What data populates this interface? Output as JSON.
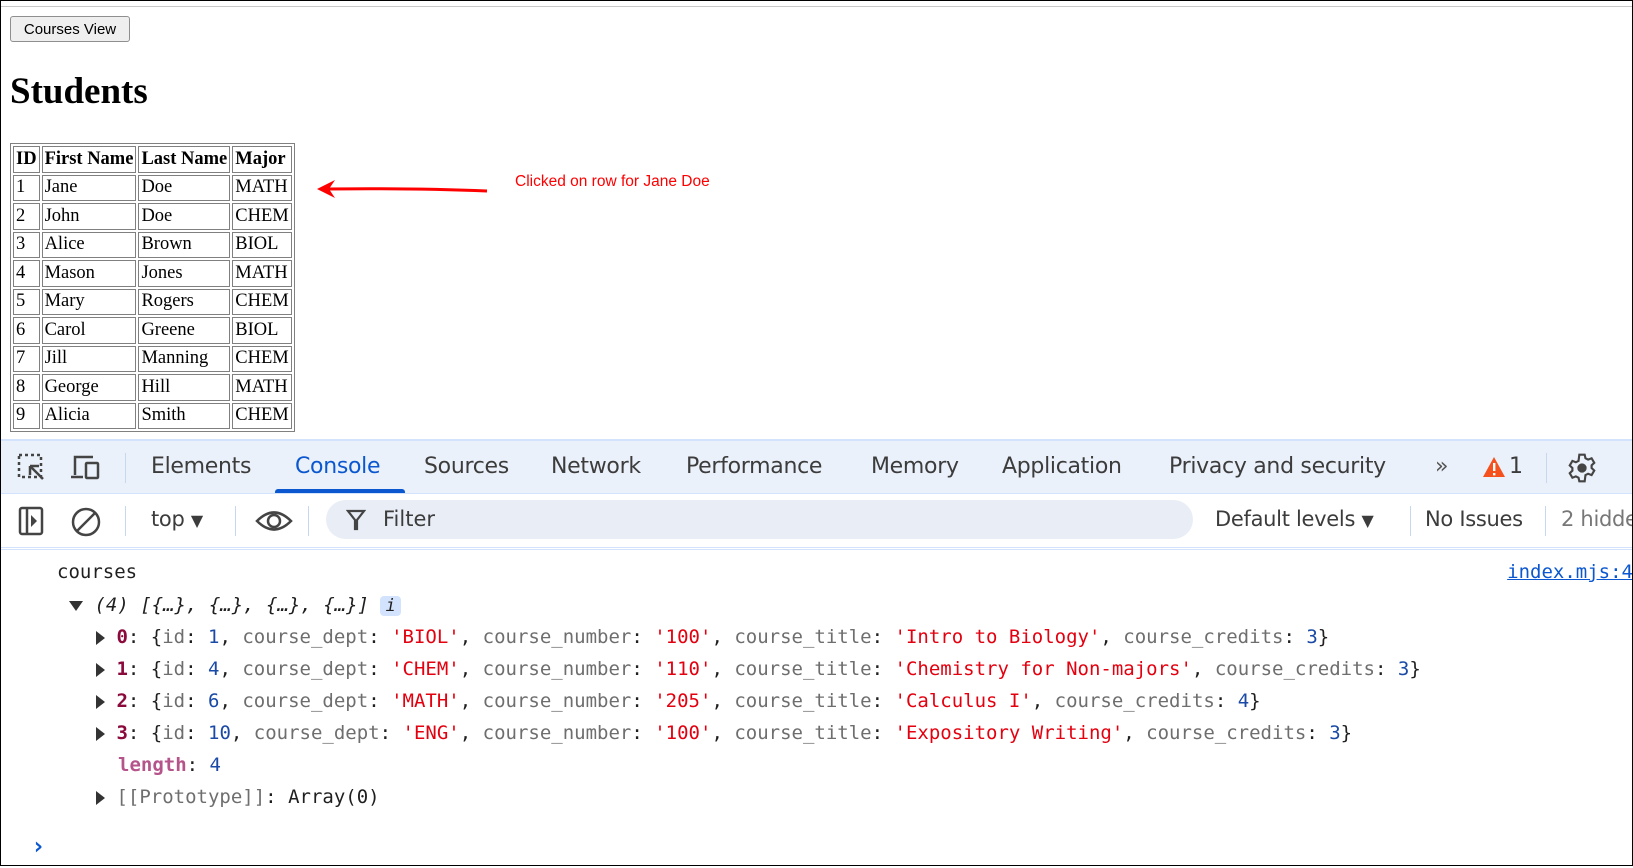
{
  "page": {
    "courses_button": "Courses View",
    "heading": "Students",
    "table": {
      "headers": [
        "ID",
        "First Name",
        "Last Name",
        "Major"
      ],
      "rows": [
        [
          "1",
          "Jane",
          "Doe",
          "MATH"
        ],
        [
          "2",
          "John",
          "Doe",
          "CHEM"
        ],
        [
          "3",
          "Alice",
          "Brown",
          "BIOL"
        ],
        [
          "4",
          "Mason",
          "Jones",
          "MATH"
        ],
        [
          "5",
          "Mary",
          "Rogers",
          "CHEM"
        ],
        [
          "6",
          "Carol",
          "Greene",
          "BIOL"
        ],
        [
          "7",
          "Jill",
          "Manning",
          "CHEM"
        ],
        [
          "8",
          "George",
          "Hill",
          "MATH"
        ],
        [
          "9",
          "Alicia",
          "Smith",
          "CHEM"
        ]
      ]
    },
    "annotation": "Clicked on row for Jane Doe",
    "annotation_color": "#ff0000"
  },
  "devtools": {
    "tabs": [
      "Elements",
      "Console",
      "Sources",
      "Network",
      "Performance",
      "Memory",
      "Application",
      "Privacy and security"
    ],
    "active_tab": "Console",
    "warning_count": "1",
    "toolbar": {
      "context": "top",
      "filter_placeholder": "Filter",
      "levels": "Default levels",
      "issues": "No Issues",
      "hidden": "2 hidde"
    },
    "console": {
      "log_label": "courses",
      "source_link": "index.mjs:4",
      "array_summary": "(4) [{…}, {…}, {…}, {…}]",
      "info_badge": "i",
      "items": [
        {
          "index": "0",
          "id": "1",
          "course_dept": "'BIOL'",
          "course_number": "'100'",
          "course_title": "'Intro to Biology'",
          "course_credits": "3"
        },
        {
          "index": "1",
          "id": "4",
          "course_dept": "'CHEM'",
          "course_number": "'110'",
          "course_title": "'Chemistry for Non-majors'",
          "course_credits": "3"
        },
        {
          "index": "2",
          "id": "6",
          "course_dept": "'MATH'",
          "course_number": "'205'",
          "course_title": "'Calculus I'",
          "course_credits": "4"
        },
        {
          "index": "3",
          "id": "10",
          "course_dept": "'ENG'",
          "course_number": "'100'",
          "course_title": "'Expository Writing'",
          "course_credits": "3"
        }
      ],
      "length_key": "length",
      "length_value": "4",
      "prototype_key": "[[Prototype]]",
      "prototype_value": "Array(0)",
      "prompt": "›"
    }
  }
}
